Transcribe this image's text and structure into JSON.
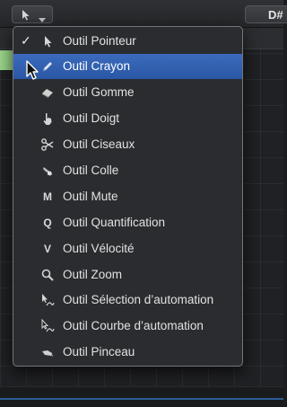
{
  "toolbar": {
    "tool_button_icon": "pointer-arrow-icon",
    "key_label": "D#"
  },
  "menu": {
    "items": [
      {
        "label": "Outil Pointeur",
        "icon": "pointer-icon",
        "checked": true,
        "selected": false
      },
      {
        "label": "Outil Crayon",
        "icon": "pencil-icon",
        "checked": false,
        "selected": true
      },
      {
        "label": "Outil Gomme",
        "icon": "eraser-icon",
        "checked": false,
        "selected": false
      },
      {
        "label": "Outil Doigt",
        "icon": "finger-icon",
        "checked": false,
        "selected": false
      },
      {
        "label": "Outil Ciseaux",
        "icon": "scissors-icon",
        "checked": false,
        "selected": false
      },
      {
        "label": "Outil Colle",
        "icon": "glue-icon",
        "checked": false,
        "selected": false
      },
      {
        "label": "Outil Mute",
        "icon": "mute-icon",
        "icon_text": "M",
        "checked": false,
        "selected": false
      },
      {
        "label": "Outil Quantification",
        "icon": "quantize-icon",
        "icon_text": "Q",
        "checked": false,
        "selected": false
      },
      {
        "label": "Outil Vélocité",
        "icon": "velocity-icon",
        "icon_text": "V",
        "checked": false,
        "selected": false
      },
      {
        "label": "Outil Zoom",
        "icon": "zoom-icon",
        "checked": false,
        "selected": false
      },
      {
        "label": "Outil Sélection d’automation",
        "icon": "automation-select-icon",
        "checked": false,
        "selected": false
      },
      {
        "label": "Outil Courbe d’automation",
        "icon": "automation-curve-icon",
        "checked": false,
        "selected": false
      },
      {
        "label": "Outil Pinceau",
        "icon": "brush-icon",
        "checked": false,
        "selected": false
      }
    ],
    "check_mark": "✓"
  },
  "colors": {
    "menu_bg": "#2b2c2f",
    "selected_bg": "#2f5fae",
    "text": "#e2e2e2"
  }
}
